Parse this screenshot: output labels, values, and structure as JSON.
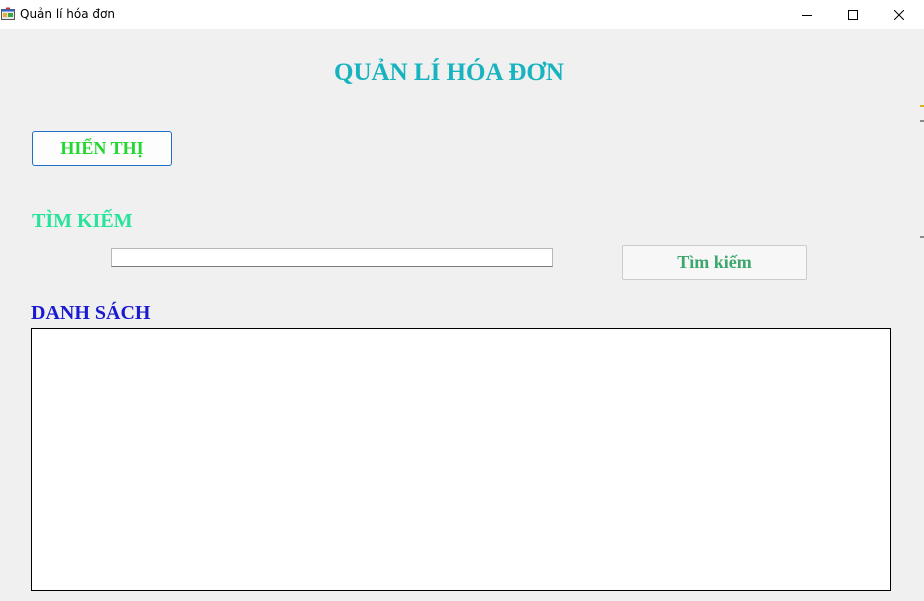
{
  "window": {
    "title": "Quản lí hóa đơn",
    "app_icon": "winforms-app-icon",
    "controls": {
      "minimize_icon": "minimize-icon",
      "maximize_icon": "maximize-icon",
      "close_icon": "close-icon"
    }
  },
  "form": {
    "heading": "QUẢN LÍ HÓA ĐƠN",
    "show_button_label": "HIỂN THỊ",
    "search_label": "TÌM KIẾM",
    "search_input": {
      "value": "",
      "placeholder": ""
    },
    "search_button_label": "Tìm kiếm",
    "list_label": "DANH SÁCH",
    "list_rows": []
  },
  "colors": {
    "heading": "#17b3bf",
    "show_button_text": "#22d82f",
    "show_button_border": "#1e6fc8",
    "search_label": "#28e39a",
    "search_button_text": "#3ca66d",
    "list_label": "#1a1ad0",
    "window_background": "#f0f0f0",
    "titlebar_background": "#ffffff"
  }
}
